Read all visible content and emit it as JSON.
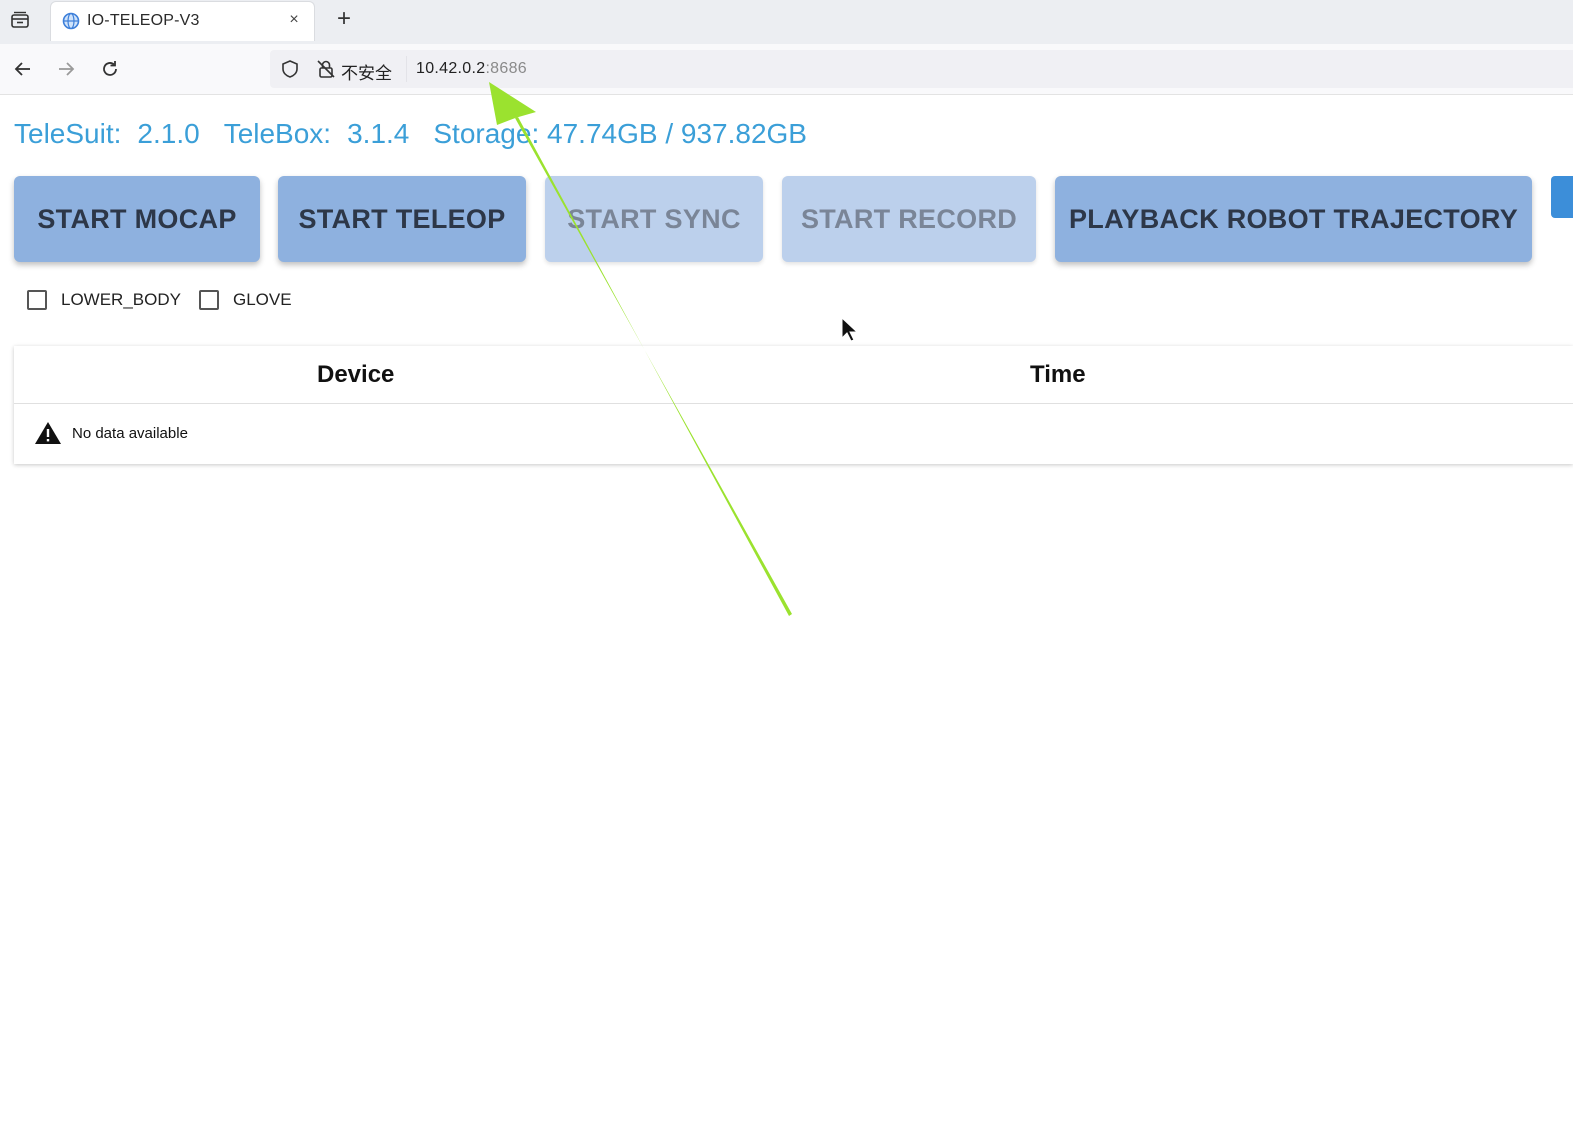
{
  "browser": {
    "tab_title": "IO-TELEOP-V3",
    "close_symbol": "×",
    "new_tab_symbol": "+",
    "security_label": "不安全",
    "url_host": "10.42.0.2",
    "url_port": ":8686",
    "icons": [
      "tab-list-icon",
      "globe-favicon-icon",
      "close-icon",
      "plus-icon",
      "back-arrow-icon",
      "forward-arrow-icon",
      "reload-icon",
      "shield-icon",
      "insecure-lock-icon"
    ]
  },
  "header": {
    "telesuit_label": "TeleSuit:",
    "telesuit_value": "2.1.0",
    "telebox_label": "TeleBox:",
    "telebox_value": "3.1.4",
    "storage_label": "Storage:",
    "storage_value": "47.74GB / 937.82GB"
  },
  "actions": {
    "start_mocap": "START MOCAP",
    "start_teleop": "START TELEOP",
    "start_sync": "START SYNC",
    "start_record": "START RECORD",
    "playback": "PLAYBACK ROBOT TRAJECTORY"
  },
  "options": {
    "lower_body": "LOWER_BODY",
    "glove": "GLOVE"
  },
  "table": {
    "columns": [
      "Device",
      "Time"
    ],
    "empty_text": "No data available"
  },
  "colors": {
    "info_text": "#3b9fd8",
    "button_bg": "#8eb1df",
    "button_disabled_bg": "#bcd0ec",
    "arrow": "#9be22f"
  }
}
